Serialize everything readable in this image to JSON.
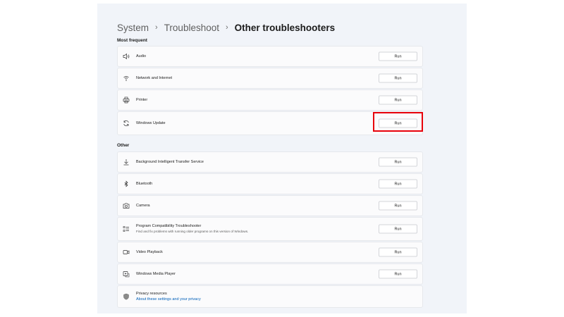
{
  "breadcrumb": {
    "system": "System",
    "troubleshoot": "Troubleshoot",
    "current": "Other troubleshooters",
    "separator": "›"
  },
  "sections": {
    "most_frequent": "Most frequent",
    "other": "Other"
  },
  "run_label": "Run",
  "items": {
    "audio": "Audio",
    "network": "Network and Internet",
    "printer": "Printer",
    "windows_update": "Windows Update",
    "bits": "Background Intelligent Transfer Service",
    "bluetooth": "Bluetooth",
    "camera": "Camera",
    "program_compat": "Program Compatibility Troubleshooter",
    "program_compat_desc": "Find and fix problems with running older programs on this version of Windows.",
    "video_playback": "Video Playback",
    "media_player": "Windows Media Player",
    "privacy": "Privacy resources",
    "privacy_link": "About these settings and your privacy"
  },
  "colors": {
    "accent_link": "#005fb8",
    "highlight": "#e8000b"
  }
}
